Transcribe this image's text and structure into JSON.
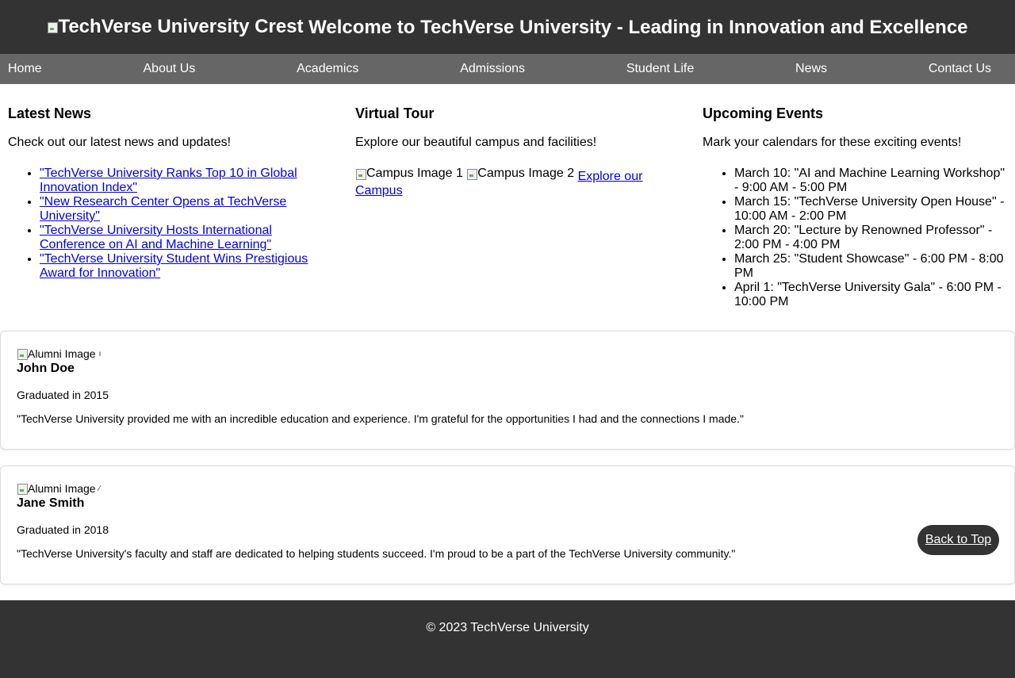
{
  "header": {
    "logo_alt": "TechVerse University Crest",
    "title": "Welcome to TechVerse University - Leading in Innovation and Excellence"
  },
  "nav": {
    "items": [
      {
        "label": "Home"
      },
      {
        "label": "About Us"
      },
      {
        "label": "Academics"
      },
      {
        "label": "Admissions"
      },
      {
        "label": "Student Life"
      },
      {
        "label": "News"
      },
      {
        "label": "Contact Us"
      }
    ]
  },
  "news": {
    "heading": "Latest News",
    "intro": "Check out our latest news and updates!",
    "items": [
      "\"TechVerse University Ranks Top 10 in Global Innovation Index\"",
      "\"New Research Center Opens at TechVerse University\"",
      "\"TechVerse University Hosts International Conference on AI and Machine Learning\"",
      "\"TechVerse University Student Wins Prestigious Award for Innovation\""
    ]
  },
  "tour": {
    "heading": "Virtual Tour",
    "intro": "Explore our beautiful campus and facilities!",
    "image1_alt": "Campus Image 1",
    "image2_alt": "Campus Image 2",
    "link": "Explore our Campus"
  },
  "events": {
    "heading": "Upcoming Events",
    "intro": "Mark your calendars for these exciting events!",
    "items": [
      "March 10: \"AI and Machine Learning Workshop\" - 9:00 AM - 5:00 PM",
      "March 15: \"TechVerse University Open House\" - 10:00 AM - 2:00 PM",
      "March 20: \"Lecture by Renowned Professor\" - 2:00 PM - 4:00 PM",
      "March 25: \"Student Showcase\" - 6:00 PM - 8:00 PM",
      "April 1: \"TechVerse University Gala\" - 6:00 PM - 10:00 PM"
    ]
  },
  "alumni": [
    {
      "image_alt": "Alumni Image",
      "name": "John Doe",
      "graduated": "Graduated in 2015",
      "quote": "\"TechVerse University provided me with an incredible education and experience. I'm grateful for the opportunities I had and the connections I made.\""
    },
    {
      "image_alt": "Alumni Image",
      "name": "Jane Smith",
      "graduated": "Graduated in 2018",
      "quote": "\"TechVerse University's faculty and staff are dedicated to helping students succeed. I'm proud to be a part of the TechVerse University community.\""
    }
  ],
  "back_to_top": "Back to Top",
  "footer": {
    "text": "© 2023 TechVerse University"
  }
}
